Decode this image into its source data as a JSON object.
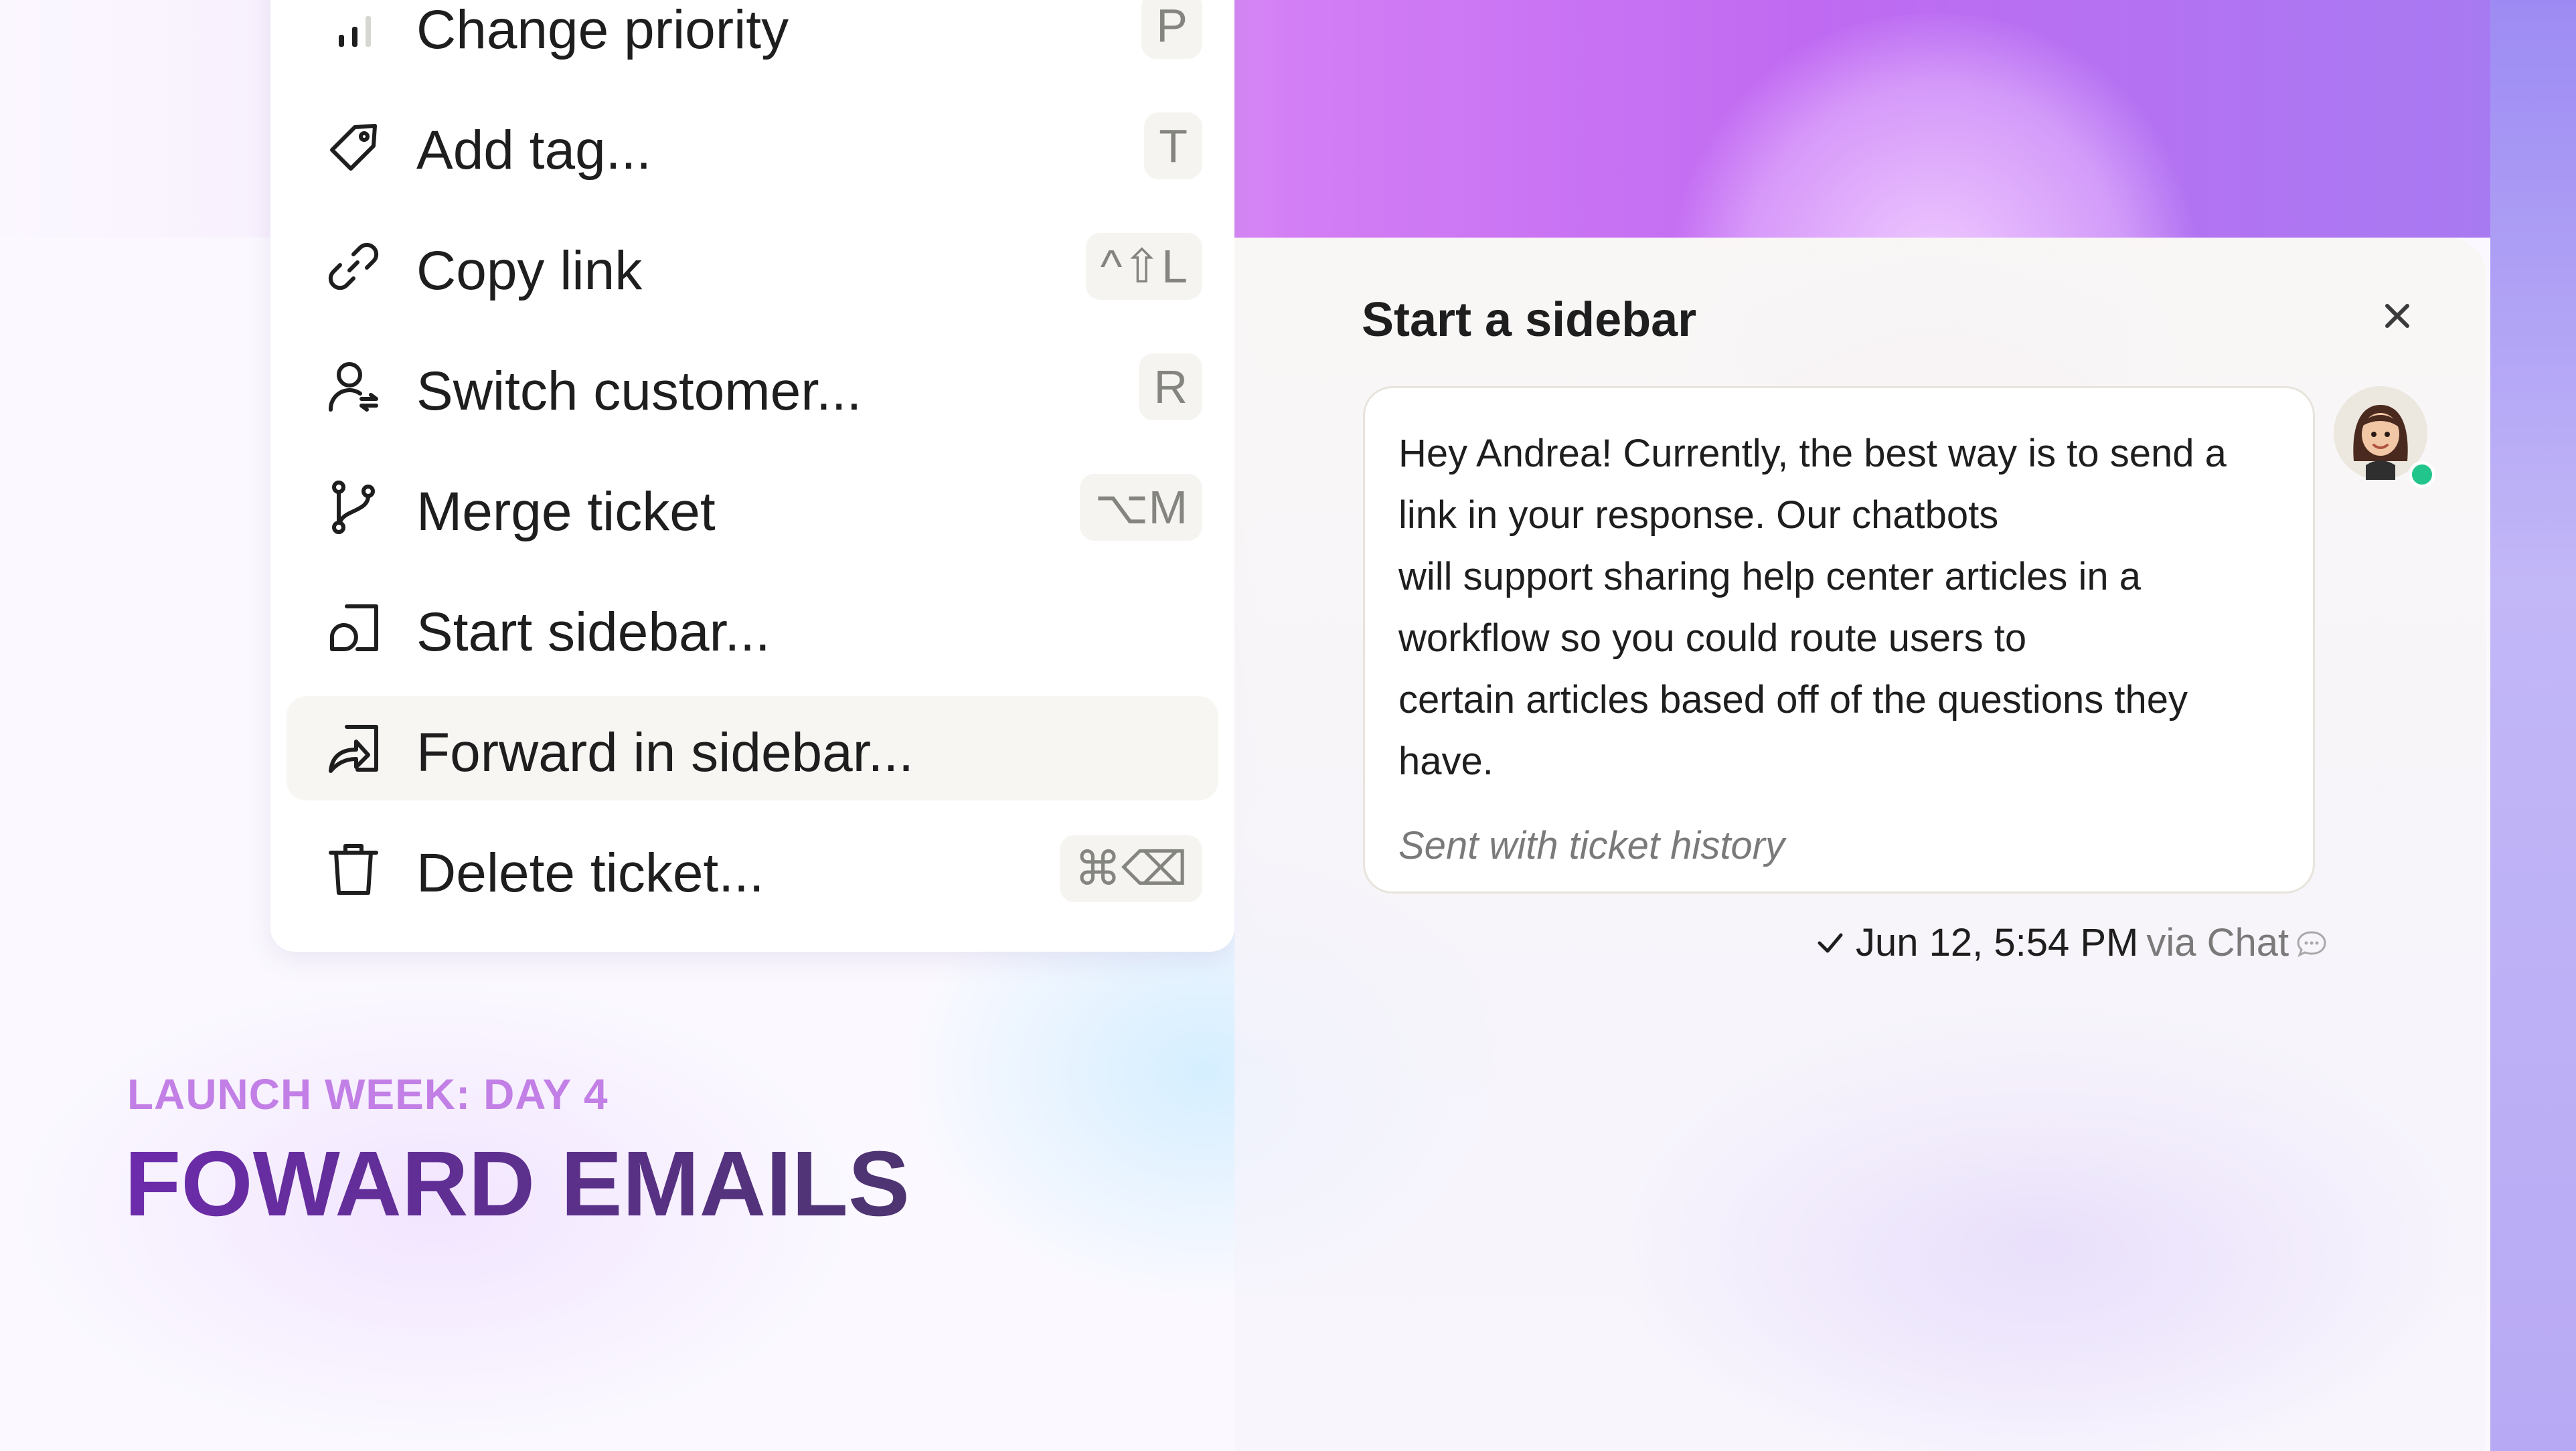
{
  "menu": {
    "items": [
      {
        "label": "Change priority",
        "shortcut": "P",
        "icon": "priority-bars-icon"
      },
      {
        "label": "Add tag...",
        "shortcut": "T",
        "icon": "tag-icon"
      },
      {
        "label": "Copy link",
        "shortcut": "^⇧L",
        "icon": "link-icon"
      },
      {
        "label": "Switch customer...",
        "shortcut": "R",
        "icon": "switch-customer-icon"
      },
      {
        "label": "Merge ticket",
        "shortcut": "⌥M",
        "icon": "merge-icon"
      },
      {
        "label": "Start sidebar...",
        "shortcut": "",
        "icon": "sidebar-chat-icon"
      },
      {
        "label": "Forward in sidebar...",
        "shortcut": "",
        "icon": "forward-icon",
        "active": true
      },
      {
        "label": "Delete ticket...",
        "shortcut": "⌘⌫",
        "icon": "trash-icon"
      }
    ]
  },
  "sidebar_panel": {
    "title": "Start a sidebar",
    "message_lines": [
      "Hey Andrea! Currently, the best way is to send a",
      "link in your response. Our chatbots",
      "will support sharing help center articles in a",
      "workflow so you could route users to",
      "certain articles based off of the questions they",
      "have."
    ],
    "note": "Sent with ticket history",
    "timestamp": "Jun 12, 5:54 PM",
    "channel": "via Chat",
    "status_color": "#22c58b"
  },
  "headline": {
    "eyebrow": "LAUNCH WEEK: DAY 4",
    "title": "FOWARD EMAILS"
  },
  "colors": {
    "accent_purple": "#6c2bab",
    "eyebrow_purple": "#c27fe6",
    "active_row": "#f7f6f3"
  }
}
